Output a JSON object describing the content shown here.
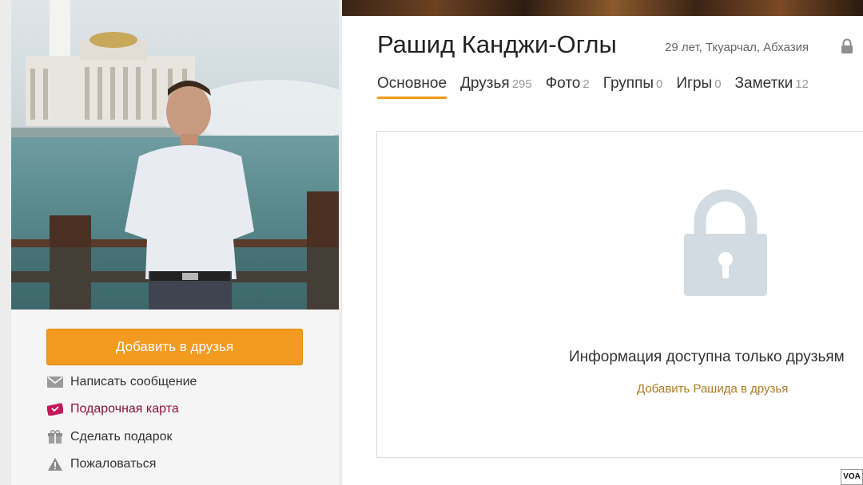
{
  "profile": {
    "name": "Рашид Канджи-Оглы",
    "meta": "29 лет, Ткуарчал, Абхазия"
  },
  "tabs": [
    {
      "label": "Основное",
      "count": ""
    },
    {
      "label": "Друзья",
      "count": "295"
    },
    {
      "label": "Фото",
      "count": "2"
    },
    {
      "label": "Группы",
      "count": "0"
    },
    {
      "label": "Игры",
      "count": "0"
    },
    {
      "label": "Заметки",
      "count": "12"
    }
  ],
  "actions": {
    "add_friend_label": "Добавить в друзья",
    "message_label": "Написать сообщение",
    "gift_card_label": "Подарочная карта",
    "gift_label": "Сделать подарок",
    "report_label": "Пожаловаться"
  },
  "closed": {
    "message": "Информация доступна только друзьям",
    "add_link": "Добавить Рашида в друзья"
  },
  "watermark": "VOA",
  "colors": {
    "accent": "#f39b1f",
    "gift_card_text": "#8a1538",
    "link": "#b07a22",
    "lock": "#d3dbe2"
  },
  "icons": {
    "message": "envelope-icon",
    "gift_card": "gift-card-icon",
    "gift": "gift-icon",
    "report": "warning-icon",
    "privacy": "lock-icon"
  }
}
